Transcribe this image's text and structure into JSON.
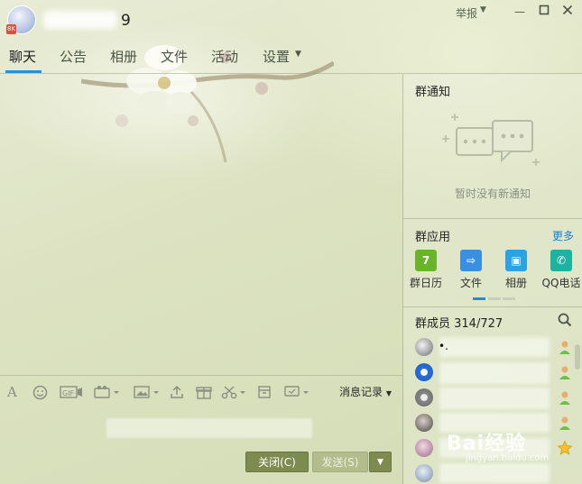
{
  "window": {
    "group_name_suffix": "9",
    "avatar_badge": "8K",
    "report_label": "举报",
    "controls": [
      "minimize",
      "maximize",
      "close"
    ]
  },
  "tabs": [
    {
      "label": "聊天",
      "active": true
    },
    {
      "label": "公告",
      "active": false
    },
    {
      "label": "相册",
      "active": false
    },
    {
      "label": "文件",
      "active": false
    },
    {
      "label": "活动",
      "active": false
    },
    {
      "label": "设置",
      "active": false
    }
  ],
  "toolbar": {
    "icons": [
      "font-icon",
      "emoji-icon",
      "gif-icon",
      "video-icon",
      "image-icon",
      "upload-icon",
      "gift-icon",
      "screenshot-icon",
      "doc-icon",
      "feedback-icon"
    ],
    "message_record_label": "消息记录"
  },
  "buttons": {
    "close_label": "关闭(C)",
    "send_label": "发送(S)"
  },
  "notice": {
    "title": "群通知",
    "empty_text": "暂时没有新通知"
  },
  "apps": {
    "title": "群应用",
    "more_label": "更多",
    "items": [
      {
        "label": "群日历",
        "icon": "calendar-icon",
        "color": "#6ab42a",
        "glyph": "7"
      },
      {
        "label": "文件",
        "icon": "file-icon",
        "color": "#3b8fe0",
        "glyph": "⇨"
      },
      {
        "label": "相册",
        "icon": "album-icon",
        "color": "#2aa3e0",
        "glyph": "▣"
      },
      {
        "label": "QQ电话",
        "icon": "phone-icon",
        "color": "#1eb3a0",
        "glyph": "✆"
      }
    ]
  },
  "members": {
    "title": "群成员 314/727",
    "rows": [
      {
        "name": "•.",
        "role": "member"
      },
      {
        "name": "",
        "role": "member"
      },
      {
        "name": "",
        "role": "member"
      },
      {
        "name": "",
        "role": "member"
      },
      {
        "name": "",
        "role": "admin"
      },
      {
        "name": "",
        "role": "member"
      }
    ]
  },
  "watermark": {
    "brand": "Bai经验",
    "url": "jingyan.baidu.com"
  },
  "colors": {
    "accent": "#2a8fd8",
    "button_primary": "#7d8b50",
    "link": "#1a7fd0"
  }
}
